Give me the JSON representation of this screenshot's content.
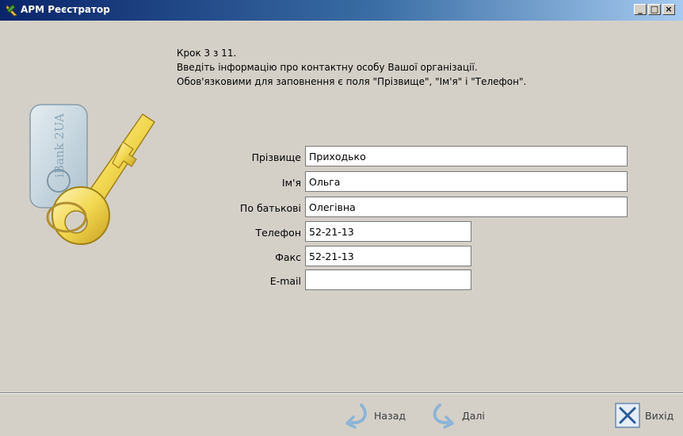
{
  "window": {
    "title": "АРМ Реєстратор",
    "controls": {
      "minimize": "_",
      "maximize": "□",
      "close": "×"
    }
  },
  "instructions": {
    "step": "Крок 3 з 11.",
    "line1": "Введіть інформацію про контактну особу Вашої організації.",
    "line2": "Обов'язковими для заповнення є поля \"Прізвище\", \"Ім'я\" і \"Телефон\"."
  },
  "illustration": {
    "tag_text": "iBank 2UA",
    "icon": "key-icon"
  },
  "form": {
    "surname": {
      "label": "Прізвище",
      "value": "Приходько"
    },
    "name": {
      "label": "Ім'я",
      "value": "Ольга"
    },
    "patronymic": {
      "label": "По батькові",
      "value": "Олегівна"
    },
    "phone": {
      "label": "Телефон",
      "value": "52-21-13"
    },
    "fax": {
      "label": "Факс",
      "value": "52-21-13"
    },
    "email": {
      "label": "E-mail",
      "value": ""
    }
  },
  "buttons": {
    "back": {
      "label": "Назад",
      "icon": "arrow-back-icon"
    },
    "next": {
      "label": "Далі",
      "icon": "arrow-next-icon"
    },
    "exit": {
      "label": "Вихід",
      "icon": "exit-x-icon"
    }
  }
}
